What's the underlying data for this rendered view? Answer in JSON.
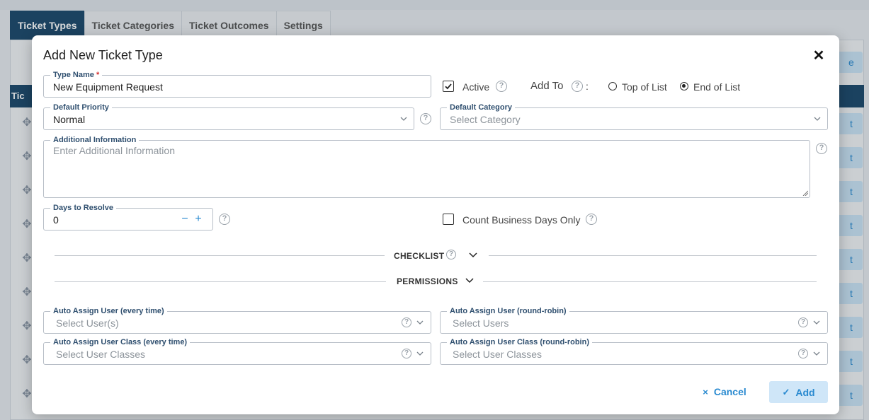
{
  "tabs": [
    {
      "label": "Ticket Types",
      "active": true
    },
    {
      "label": "Ticket Categories",
      "active": false
    },
    {
      "label": "Ticket Outcomes",
      "active": false
    },
    {
      "label": "Settings",
      "active": false
    }
  ],
  "background": {
    "table_header_partial": "Tic",
    "right_button_partial": "e",
    "row_button_partial": "t"
  },
  "modal": {
    "title": "Add New Ticket Type",
    "close_icon": "close-icon",
    "type_name": {
      "label": "Type Name",
      "required_mark": "*",
      "value": "New Equipment Request"
    },
    "active": {
      "label": "Active",
      "checked": true
    },
    "add_to": {
      "label": "Add To",
      "colon": ":",
      "options": [
        "Top of List",
        "End of List"
      ],
      "selected": "End of List"
    },
    "default_priority": {
      "label": "Default Priority",
      "value": "Normal"
    },
    "default_category": {
      "label": "Default Category",
      "placeholder": "Select Category"
    },
    "additional_information": {
      "label": "Additional Information",
      "placeholder": "Enter Additional Information"
    },
    "days_to_resolve": {
      "label": "Days to Resolve",
      "value": "0",
      "minus": "−",
      "plus": "+"
    },
    "count_business_days": {
      "label": "Count Business Days Only",
      "checked": false
    },
    "checklist": {
      "label": "CHECKLIST"
    },
    "permissions": {
      "label": "PERMISSIONS"
    },
    "auto_assign_user_every": {
      "label": "Auto Assign User (every time)",
      "placeholder": "Select User(s)"
    },
    "auto_assign_user_rr": {
      "label": "Auto Assign User (round-robin)",
      "placeholder": "Select Users"
    },
    "auto_assign_class_every": {
      "label": "Auto Assign User Class (every time)",
      "placeholder": "Select User Classes"
    },
    "auto_assign_class_rr": {
      "label": "Auto Assign User Class (round-robin)",
      "placeholder": "Select User Classes"
    },
    "help_glyph": "?",
    "cancel": {
      "label": "Cancel",
      "icon": "×"
    },
    "add": {
      "label": "Add",
      "icon": "✓"
    }
  },
  "colors": {
    "header_navy": "#19466a",
    "accent_blue": "#2a8ad0",
    "add_button_bg": "#cfe6f8",
    "required_red": "#d32f2f"
  }
}
